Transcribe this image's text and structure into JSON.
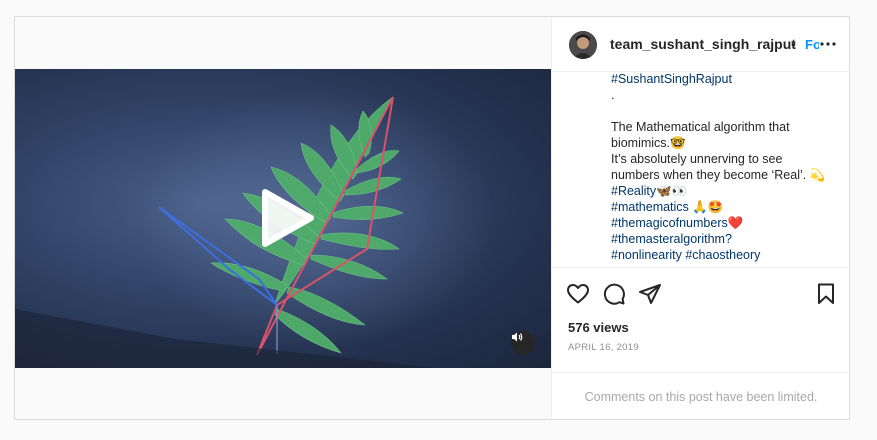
{
  "post": {
    "username": "team_sushant_singh_rajput",
    "separator": "•",
    "follow_label": "Follow",
    "caption_lines": [
      {
        "text": "#SushantSinghRajput",
        "kind": "tag"
      },
      {
        "text": ".",
        "kind": "plain"
      },
      {
        "text": "",
        "kind": "plain"
      },
      {
        "text": "The Mathematical algorithm that",
        "kind": "plain"
      },
      {
        "text": "biomimics.🤓",
        "kind": "plain"
      },
      {
        "text": "It’s absolutely unnerving to see",
        "kind": "plain"
      },
      {
        "text": "numbers when they become ‘Real’. 💫",
        "kind": "plain"
      },
      {
        "text": "#Reality🦋👀",
        "kind": "tag"
      },
      {
        "text": "#mathematics 🙏🤩",
        "kind": "tag"
      },
      {
        "text": "#themagicofnumbers❤️",
        "kind": "tag"
      },
      {
        "text": "#themasteralgorithm?",
        "kind": "tag"
      },
      {
        "text": "#nonlinearity #chaostheory",
        "kind": "tag"
      }
    ],
    "views": "576 views",
    "date": "APRIL 16, 2019",
    "comments_limited": "Comments on this post have been limited."
  },
  "colors": {
    "link": "#00376b",
    "follow": "#0095f6",
    "fern": "#4fae6a"
  },
  "icons": {
    "play": "play-icon",
    "mute": "speaker-icon",
    "like": "heart-icon",
    "comment": "comment-icon",
    "share": "share-icon",
    "save": "bookmark-icon",
    "more": "more-options-icon"
  }
}
